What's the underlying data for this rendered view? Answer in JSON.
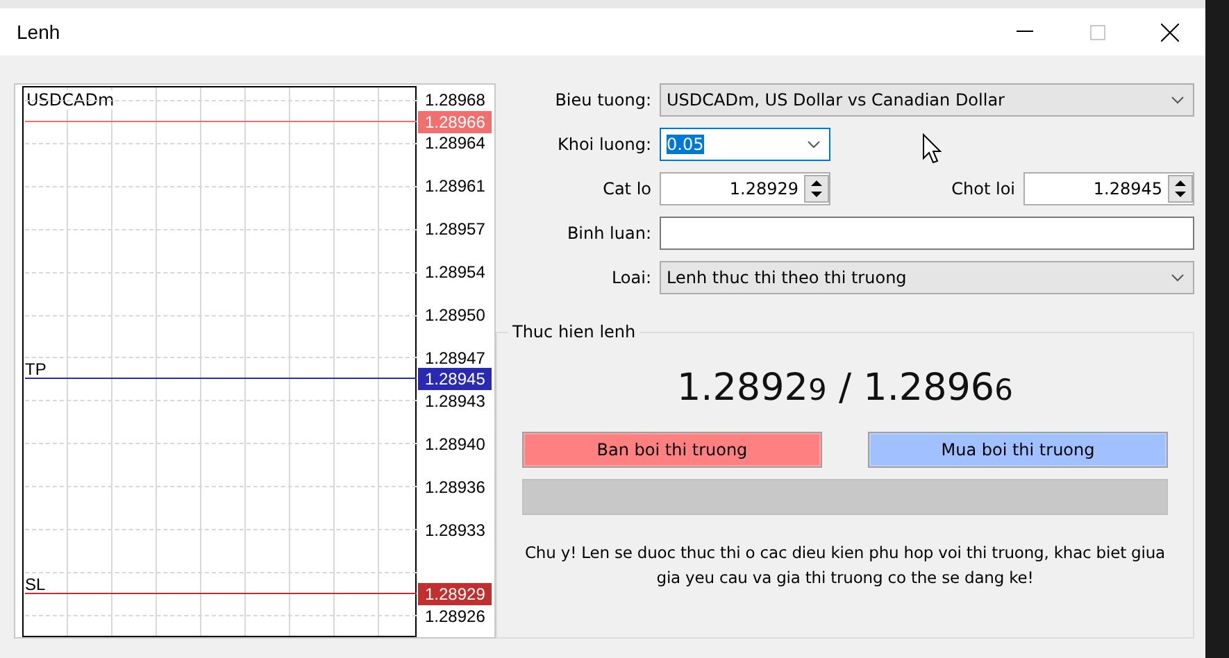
{
  "window": {
    "title": "Lenh",
    "maximize_disabled": true
  },
  "chart": {
    "symbol": "USDCADm",
    "axis": [
      {
        "kind": "tick",
        "label": "1.28968"
      },
      {
        "kind": "tag",
        "label": "1.28966",
        "color": "#f07070"
      },
      {
        "kind": "tick",
        "label": "1.28964"
      },
      {
        "kind": "tick",
        "label": "1.28961"
      },
      {
        "kind": "tick",
        "label": "1.28957"
      },
      {
        "kind": "tick",
        "label": "1.28954"
      },
      {
        "kind": "tick",
        "label": "1.28950"
      },
      {
        "kind": "tick",
        "label": "1.28947"
      },
      {
        "kind": "tag",
        "label": "1.28945",
        "color": "#2a2ab0",
        "line_label": "TP"
      },
      {
        "kind": "tick",
        "label": "1.28943"
      },
      {
        "kind": "tick",
        "label": "1.28940"
      },
      {
        "kind": "tick",
        "label": "1.28936"
      },
      {
        "kind": "tick",
        "label": "1.28933"
      },
      {
        "kind": "covered"
      },
      {
        "kind": "tag",
        "label": "1.28929",
        "color": "#c03030",
        "line_label": "SL"
      },
      {
        "kind": "tick",
        "label": "1.28926"
      }
    ]
  },
  "form": {
    "symbol": {
      "label": "Bieu tuong:",
      "value": "USDCADm, US Dollar vs Canadian Dollar"
    },
    "volume": {
      "label": "Khoi luong:",
      "value": "0.05",
      "focused": true
    },
    "stop_loss": {
      "label": "Cat lo",
      "value": "1.28929"
    },
    "take_profit": {
      "label": "Chot loi",
      "value": "1.28945"
    },
    "comment": {
      "label": "Binh luan:"
    },
    "type": {
      "label": "Loai:",
      "value": "Lenh thuc thi theo thi truong"
    }
  },
  "execution": {
    "title": "Thuc hien lenh",
    "bid": {
      "main": "1.2892",
      "last": "9"
    },
    "separator": "/",
    "ask": {
      "main": "1.2896",
      "last": "6"
    },
    "buttons": [
      {
        "label": "Ban boi thi truong",
        "color": "#ff8080"
      },
      {
        "label": "Mua boi thi truong",
        "color": "#a0c0ff"
      }
    ],
    "note": "Chu y! Len se duoc thuc thi o cac dieu kien phu hop voi thi truong, khac biet giua gia yeu cau va gia thi truong co the se dang ke!"
  }
}
